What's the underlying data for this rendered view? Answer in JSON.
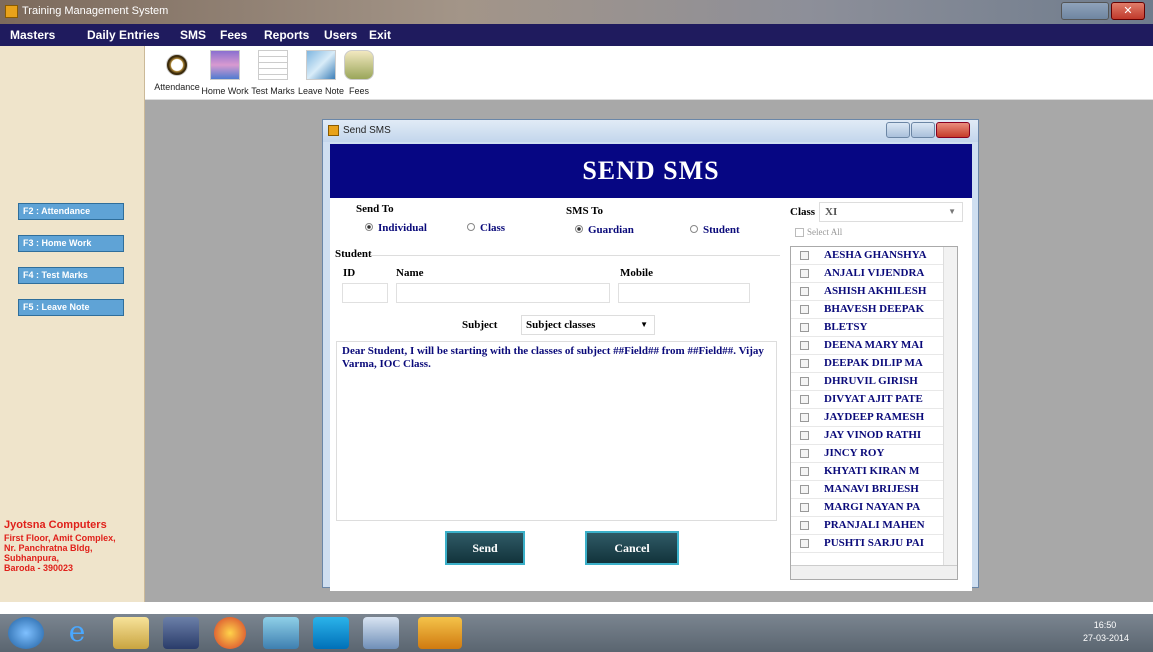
{
  "window": {
    "title": "Training Management System"
  },
  "menu": [
    "Masters",
    "Daily Entries",
    "SMS",
    "Fees",
    "Reports",
    "Users",
    "Exit"
  ],
  "toolbar": [
    "Attendance",
    "Home Work",
    "Test Marks",
    "Leave Note",
    "Fees"
  ],
  "sidebar": {
    "buttons": [
      "F2 : Attendance",
      "F3 : Home Work",
      "F4 : Test Marks",
      "F5 : Leave Note"
    ],
    "company": {
      "name": "Jyotsna Computers",
      "address": [
        "First Floor, Amit Complex,",
        "Nr. Panchratna Bldg,",
        "Subhanpura,",
        "Baroda - 390023"
      ]
    }
  },
  "dialog": {
    "title": "Send SMS",
    "header": "SEND SMS",
    "send_to": {
      "label": "Send To",
      "options": [
        "Individual",
        "Class"
      ],
      "selected": "Individual"
    },
    "sms_to": {
      "label": "SMS To",
      "options": [
        "Guardian",
        "Student"
      ],
      "selected": "Guardian"
    },
    "student": {
      "section": "Student",
      "id_label": "ID",
      "name_label": "Name",
      "mobile_label": "Mobile",
      "id": "",
      "name": "",
      "mobile": ""
    },
    "subject": {
      "label": "Subject",
      "value": "Subject classes"
    },
    "message": "Dear Student, I will be starting with the classes of subject ##Field## from ##Field##. Vijay Varma, IOC Class.",
    "class": {
      "label": "Class",
      "value": "XI"
    },
    "select_all": "Select All",
    "students": [
      "AESHA GHANSHYA",
      "ANJALI VIJENDRA",
      "ASHISH AKHILESH",
      "BHAVESH DEEPAK",
      "BLETSY",
      "DEENA MARY MAI",
      "DEEPAK DILIP MA",
      "DHRUVIL GIRISH",
      "DIVYAT AJIT PATE",
      "JAYDEEP RAMESH",
      "JAY VINOD RATHI",
      "JINCY ROY",
      "KHYATI KIRAN M",
      "MANAVI BRIJESH",
      "MARGI NAYAN PA",
      "PRANJALI MAHEN",
      "PUSHTI SARJU PAI"
    ],
    "buttons": {
      "send": "Send",
      "cancel": "Cancel"
    }
  },
  "taskbar": {
    "time": "16:50",
    "date": "27-03-2014"
  }
}
